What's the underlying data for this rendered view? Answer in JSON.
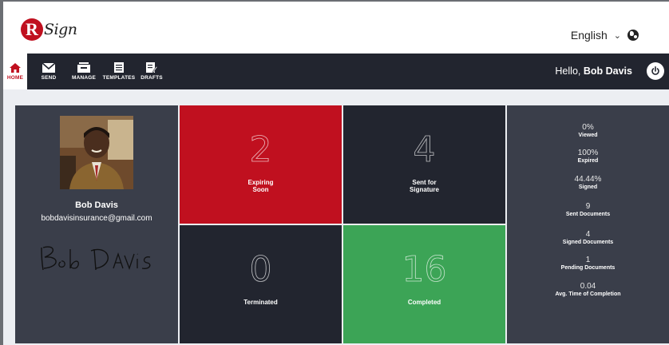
{
  "header": {
    "logo_initial": "R",
    "logo_text": "Sign",
    "language": "English"
  },
  "nav": {
    "items": [
      {
        "label": "HOME",
        "icon": "home-icon"
      },
      {
        "label": "SEND",
        "icon": "envelope-icon"
      },
      {
        "label": "MANAGE",
        "icon": "inbox-icon"
      },
      {
        "label": "TEMPLATES",
        "icon": "document-icon"
      },
      {
        "label": "DRAFTS",
        "icon": "draft-icon"
      }
    ],
    "greeting": "Hello,",
    "user_name": "Bob Davis"
  },
  "profile": {
    "name": "Bob Davis",
    "email": "bobdavisinsurance@gmail.com",
    "signature": "Bob Davis"
  },
  "tiles": [
    {
      "value": "2",
      "label_line1": "Expiring",
      "label_line2": "Soon",
      "color": "#c0101f"
    },
    {
      "value": "4",
      "label_line1": "Sent for",
      "label_line2": "Signature",
      "color": "#22252f"
    },
    {
      "value": "0",
      "label_line1": "Terminated",
      "label_line2": "",
      "color": "#22252f"
    },
    {
      "value": "16",
      "label_line1": "Completed",
      "label_line2": "",
      "color": "#3ca456"
    }
  ],
  "stats": [
    {
      "value": "0%",
      "label": "Viewed"
    },
    {
      "value": "100%",
      "label": "Expired"
    },
    {
      "value": "44.44%",
      "label": "Signed"
    },
    {
      "value": "9",
      "label": "Sent Documents"
    },
    {
      "value": "4",
      "label": "Signed Documents"
    },
    {
      "value": "1",
      "label": "Pending Documents"
    },
    {
      "value": "0.04",
      "label": "Avg. Time of Completion"
    }
  ]
}
